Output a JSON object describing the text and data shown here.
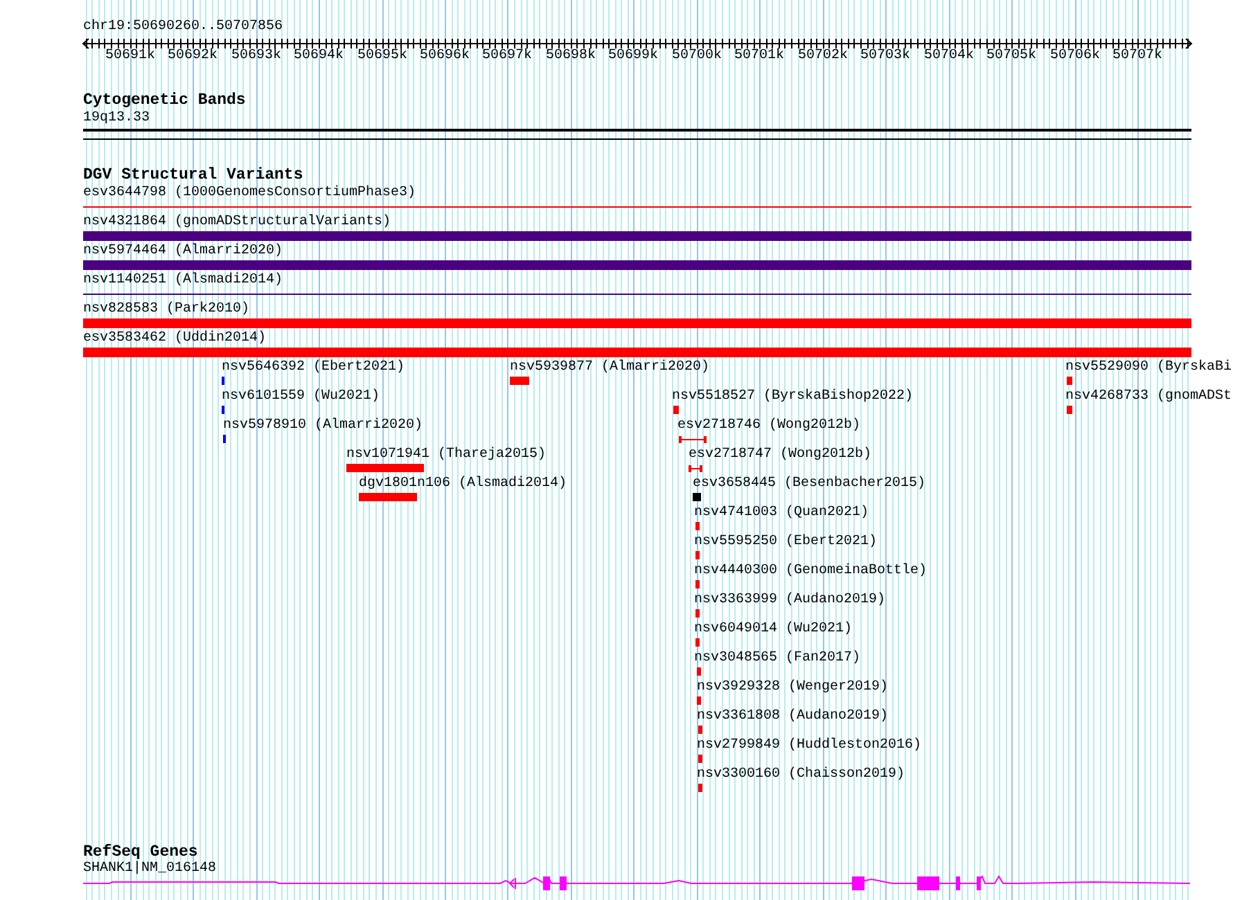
{
  "ruler": {
    "location": "chr19:50690260..50707856",
    "tick_labels": [
      "50691k",
      "50692k",
      "50693k",
      "50694k",
      "50695k",
      "50696k",
      "50697k",
      "50698k",
      "50699k",
      "50700k",
      "50701k",
      "50702k",
      "50703k",
      "50704k",
      "50705k",
      "50706k",
      "50707k"
    ]
  },
  "cytogenetic_bands": {
    "title": "Cytogenetic Bands",
    "band": "19q13.33"
  },
  "dgv_structural_variants": {
    "title": "DGV Structural Variants",
    "variants": [
      {
        "label": "esv3644798 (1000GenomesConsortiumPhase3)",
        "kind": "line",
        "color": "#ff0000"
      },
      {
        "label": "nsv4321864 (gnomADStructuralVariants)",
        "kind": "bar",
        "color": "#4b0082"
      },
      {
        "label": "nsv5974464 (Almarri2020)",
        "kind": "bar",
        "color": "#4b0082"
      },
      {
        "label": "nsv1140251 (Alsmadi2014)",
        "kind": "line",
        "color": "#4b0082"
      },
      {
        "label": "nsv828583 (Park2010)",
        "kind": "bar",
        "color": "#ff0000"
      },
      {
        "label": "esv3583462 (Uddin2014)",
        "kind": "bar",
        "color": "#ff0000"
      },
      {
        "label": "nsv5646392 (Ebert2021)",
        "kind": "bar",
        "color": "#0000ff"
      },
      {
        "label": "nsv5939877 (Almarri2020)",
        "kind": "bar",
        "color": "#ff0000"
      },
      {
        "label": "nsv5529090 (ByrskaBi",
        "kind": "bar",
        "color": "#ff0000"
      },
      {
        "label": "nsv6101559 (Wu2021)",
        "kind": "bar",
        "color": "#0000ff"
      },
      {
        "label": "nsv5518527 (ByrskaBishop2022)",
        "kind": "bar",
        "color": "#ff0000"
      },
      {
        "label": "nsv4268733 (gnomADSt",
        "kind": "bar",
        "color": "#ff0000"
      },
      {
        "label": "nsv5978910 (Almarri2020)",
        "kind": "bar",
        "color": "#0000ff"
      },
      {
        "label": "esv2718746 (Wong2012b)",
        "kind": "whisker",
        "color": "#ff0000"
      },
      {
        "label": "nsv1071941 (Thareja2015)",
        "kind": "bar",
        "color": "#ff0000"
      },
      {
        "label": "esv2718747 (Wong2012b)",
        "kind": "whisker",
        "color": "#ff0000"
      },
      {
        "label": "dgv1801n106 (Alsmadi2014)",
        "kind": "bar",
        "color": "#ff0000"
      },
      {
        "label": "esv3658445 (Besenbacher2015)",
        "kind": "bar",
        "color": "#000000"
      },
      {
        "label": "nsv4741003 (Quan2021)",
        "kind": "bar",
        "color": "#ff0000"
      },
      {
        "label": "nsv5595250 (Ebert2021)",
        "kind": "bar",
        "color": "#ff0000"
      },
      {
        "label": "nsv4440300 (GenomeinaBottle)",
        "kind": "bar",
        "color": "#ff0000"
      },
      {
        "label": "nsv3363999 (Audano2019)",
        "kind": "bar",
        "color": "#ff0000"
      },
      {
        "label": "nsv6049014 (Wu2021)",
        "kind": "bar",
        "color": "#ff0000"
      },
      {
        "label": "nsv3048565 (Fan2017)",
        "kind": "bar",
        "color": "#ff0000"
      },
      {
        "label": "nsv3929328 (Wenger2019)",
        "kind": "bar",
        "color": "#ff0000"
      },
      {
        "label": "nsv3361808 (Audano2019)",
        "kind": "bar",
        "color": "#ff0000"
      },
      {
        "label": "nsv2799849 (Huddleston2016)",
        "kind": "bar",
        "color": "#ff0000"
      },
      {
        "label": "nsv3300160 (Chaisson2019)",
        "kind": "bar",
        "color": "#ff0000"
      }
    ]
  },
  "refseq_genes": {
    "title": "RefSeq Genes",
    "gene": "SHANK1|NM_016148"
  }
}
